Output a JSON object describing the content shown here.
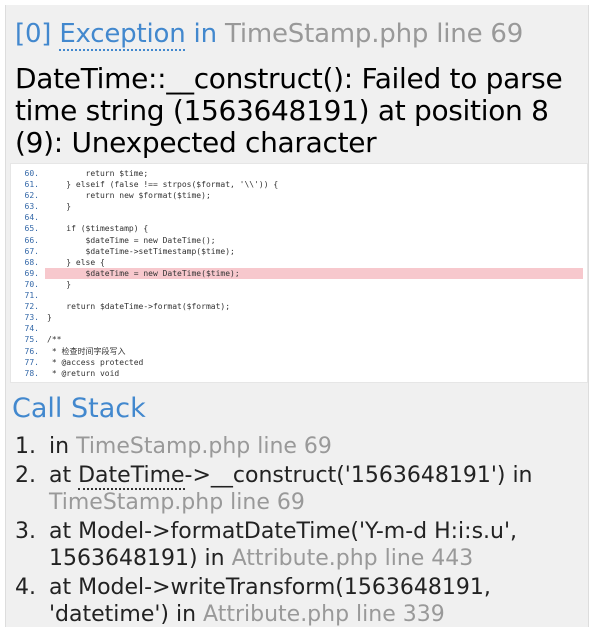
{
  "exception": {
    "index": "[0]",
    "class": "Exception",
    "in_word": "in",
    "file": "TimeStamp.php line 69",
    "message": "DateTime::__construct(): Failed to parse time string (1563648191) at position 8 (9): Unexpected character"
  },
  "source": {
    "highlight_line": "69.",
    "lines": [
      {
        "n": "60.",
        "code": "        return $time;"
      },
      {
        "n": "61.",
        "code": "    } elseif (false !== strpos($format, '\\\\')) {"
      },
      {
        "n": "62.",
        "code": "        return new $format($time);"
      },
      {
        "n": "63.",
        "code": "    }"
      },
      {
        "n": "64.",
        "code": ""
      },
      {
        "n": "65.",
        "code": "    if ($timestamp) {"
      },
      {
        "n": "66.",
        "code": "        $dateTime = new DateTime();"
      },
      {
        "n": "67.",
        "code": "        $dateTime->setTimestamp($time);"
      },
      {
        "n": "68.",
        "code": "    } else {"
      },
      {
        "n": "69.",
        "code": "        $dateTime = new DateTime($time);"
      },
      {
        "n": "70.",
        "code": "    }"
      },
      {
        "n": "71.",
        "code": ""
      },
      {
        "n": "72.",
        "code": "    return $dateTime->format($format);"
      },
      {
        "n": "73.",
        "code": "}"
      },
      {
        "n": "74.",
        "code": ""
      },
      {
        "n": "75.",
        "code": "/**"
      },
      {
        "n": "76.",
        "code": " * 检查时间字段写入"
      },
      {
        "n": "77.",
        "code": " * @access protected"
      },
      {
        "n": "78.",
        "code": " * @return void"
      }
    ]
  },
  "call_stack": {
    "title": "Call Stack",
    "items": [
      {
        "num": "1.",
        "pre": "in",
        "abbr": "",
        "mid": "",
        "file": "TimeStamp.php line 69"
      },
      {
        "num": "2.",
        "pre": "at",
        "abbr": "DateTime",
        "mid": "->__construct('1563648191') in",
        "file": "TimeStamp.php line 69"
      },
      {
        "num": "3.",
        "pre": "at",
        "abbr": "",
        "mid": "Model->formatDateTime('Y-m-d H:i:s.u', 1563648191) in",
        "file": "Attribute.php line 443"
      },
      {
        "num": "4.",
        "pre": "at",
        "abbr": "",
        "mid": "Model->writeTransform(1563648191, 'datetime') in",
        "file": "Attribute.php line 339"
      }
    ]
  }
}
